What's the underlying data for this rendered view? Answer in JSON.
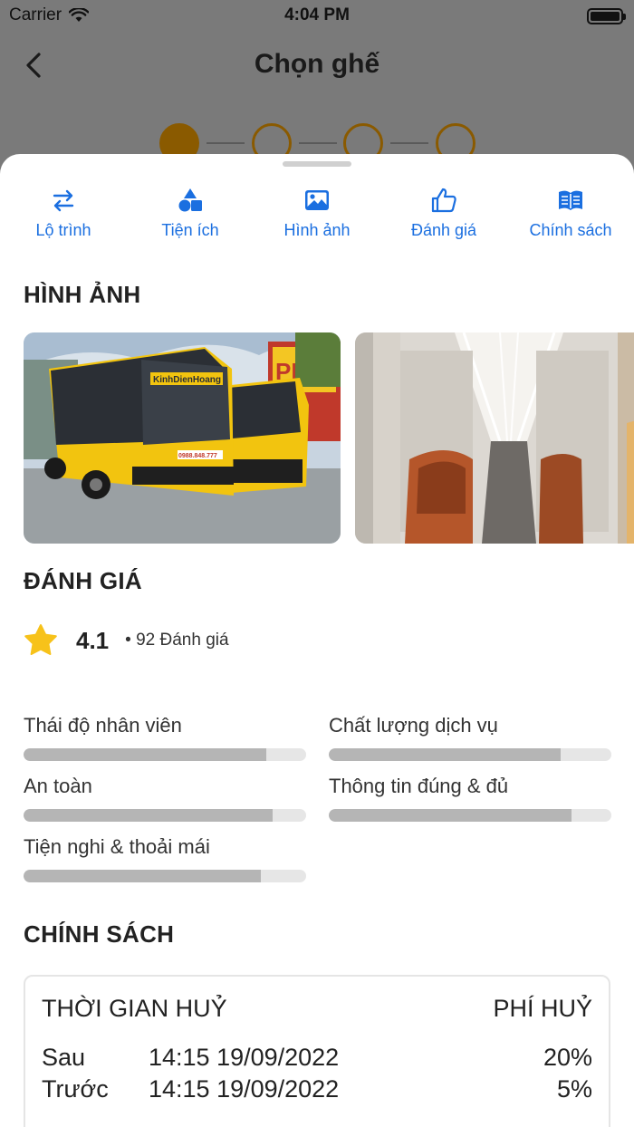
{
  "status_bar": {
    "carrier": "Carrier",
    "time": "4:04 PM"
  },
  "nav": {
    "title": "Chọn ghế"
  },
  "tabs": [
    {
      "label": "Lộ trình",
      "icon": "swap-arrows-icon"
    },
    {
      "label": "Tiện ích",
      "icon": "shapes-icon"
    },
    {
      "label": "Hình ảnh",
      "icon": "image-icon"
    },
    {
      "label": "Đánh giá",
      "icon": "thumbs-up-icon"
    },
    {
      "label": "Chính sách",
      "icon": "book-icon"
    }
  ],
  "sections": {
    "images_title": "HÌNH ẢNH",
    "review_title": "ĐÁNH GIÁ",
    "policy_title": "CHÍNH SÁCH"
  },
  "photos": {
    "bus_brand": "KinhDienHoang",
    "bus_phone": "0988.848.777",
    "shop_sign": "PHỞ"
  },
  "rating": {
    "score": "4.1",
    "count": "• 92 Đánh giá",
    "star_color": "#f7c21a"
  },
  "criteria": [
    {
      "label": "Thái độ nhân viên",
      "score": 0.86
    },
    {
      "label": "Chất lượng dịch vụ",
      "score": 0.82
    },
    {
      "label": "An toàn",
      "score": 0.88
    },
    {
      "label": "Thông tin đúng & đủ",
      "score": 0.86
    },
    {
      "label": "Tiện nghi & thoải mái",
      "score": 0.84
    }
  ],
  "policy": {
    "col_time": "THỜI GIAN HUỶ",
    "col_fee": "PHÍ HUỶ",
    "rows": [
      {
        "when": "Sau",
        "datetime": "14:15 19/09/2022",
        "fee": "20%"
      },
      {
        "when": "Trước",
        "datetime": "14:15 19/09/2022",
        "fee": "5%"
      }
    ]
  },
  "colors": {
    "accent": "#1b6fe0",
    "step": "#8a5a00",
    "bar_fill": "#b5b5b5",
    "bar_track": "#e6e6e6"
  }
}
